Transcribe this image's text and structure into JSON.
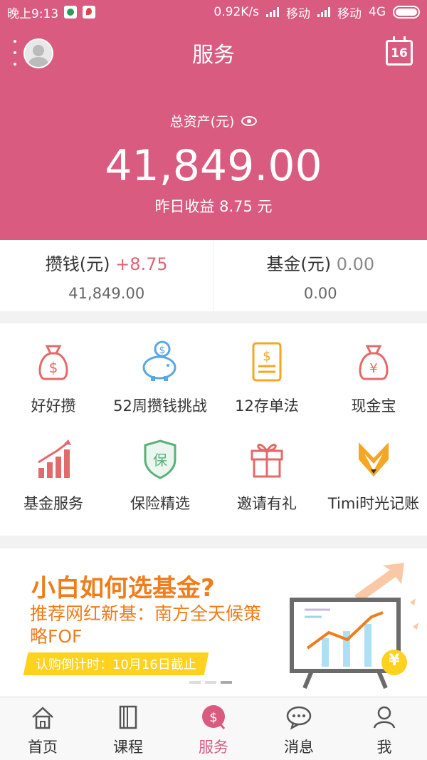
{
  "status_bar": {
    "time": "晚上9:13",
    "net_speed": "0.92K/s",
    "carrier1": "移动",
    "carrier2": "移动",
    "network": "4G"
  },
  "header": {
    "title": "服务",
    "calendar_day": "16",
    "assets_label": "总资产(元)",
    "total": "41,849.00",
    "yesterday": "昨日收益 8.75 元"
  },
  "balances": [
    {
      "label": "攒钱(元)",
      "delta": "+8.75",
      "value": "41,849.00"
    },
    {
      "label": "基金(元)",
      "delta": "0.00",
      "value": "0.00"
    }
  ],
  "services": [
    {
      "label": "好好攒",
      "icon": "money-bag-icon"
    },
    {
      "label": "52周攒钱挑战",
      "icon": "piggy-bank-icon"
    },
    {
      "label": "12存单法",
      "icon": "document-money-icon"
    },
    {
      "label": "现金宝",
      "icon": "yuan-bag-icon"
    },
    {
      "label": "基金服务",
      "icon": "growth-chart-icon"
    },
    {
      "label": "保险精选",
      "icon": "shield-icon"
    },
    {
      "label": "邀请有礼",
      "icon": "gift-icon"
    },
    {
      "label": "Timi时光记账",
      "icon": "fox-icon"
    }
  ],
  "banner": {
    "title": "小白如何选基金?",
    "subtitle": "推荐网红新基：南方全天候策略FOF",
    "countdown": "认购倒计时：10月16日截止",
    "coin": "¥"
  },
  "tabs": [
    {
      "label": "首页",
      "icon": "home-icon"
    },
    {
      "label": "课程",
      "icon": "book-icon"
    },
    {
      "label": "服务",
      "icon": "service-icon",
      "active": true
    },
    {
      "label": "消息",
      "icon": "message-icon"
    },
    {
      "label": "我",
      "icon": "user-icon"
    }
  ],
  "colors": {
    "brand": "#d95b80",
    "accent_orange": "#f07c1a",
    "icon_red": "#e36a6a",
    "icon_blue": "#5aa7e8"
  }
}
